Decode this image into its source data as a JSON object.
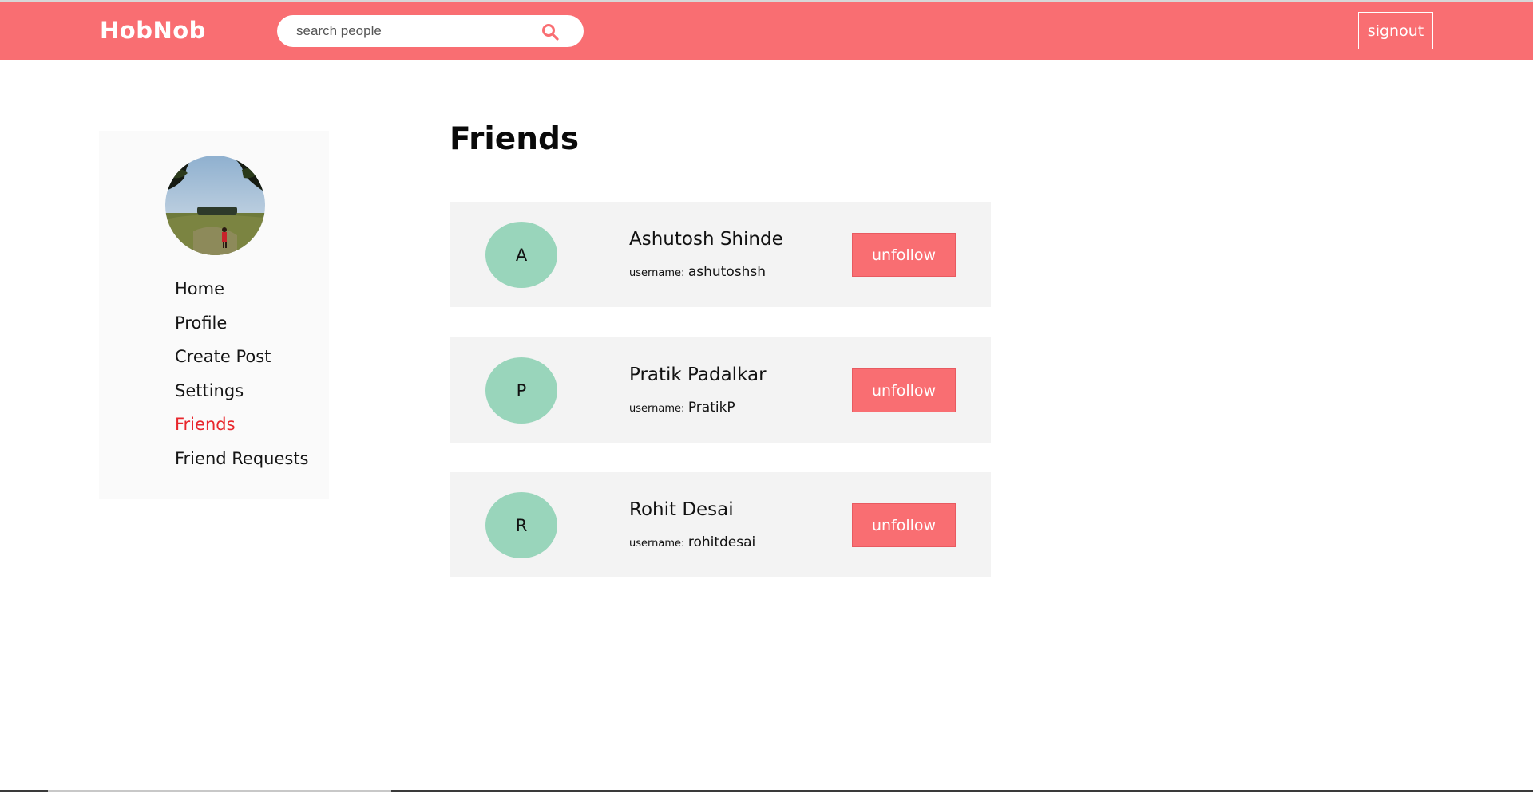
{
  "header": {
    "brand": "HobNob",
    "search_placeholder": "search people",
    "signout_label": "signout",
    "icons": {
      "search": "search-icon"
    },
    "colors": {
      "accent": "#f96e72"
    }
  },
  "sidebar": {
    "avatar": "profile-photo",
    "items": [
      {
        "label": "Home",
        "active": false
      },
      {
        "label": "Profile",
        "active": false
      },
      {
        "label": "Create Post",
        "active": false
      },
      {
        "label": "Settings",
        "active": false
      },
      {
        "label": "Friends",
        "active": true
      },
      {
        "label": "Friend Requests",
        "active": false
      }
    ]
  },
  "main": {
    "title": "Friends",
    "username_label": "username:",
    "friends": [
      {
        "initial": "A",
        "name": "Ashutosh Shinde",
        "username": "ashutoshsh",
        "action": "unfollow"
      },
      {
        "initial": "P",
        "name": "Pratik Padalkar",
        "username": "PratikP",
        "action": "unfollow"
      },
      {
        "initial": "R",
        "name": "Rohit Desai",
        "username": "rohitdesai",
        "action": "unfollow"
      }
    ],
    "colors": {
      "initial_bg": "#99d5bb",
      "card_bg": "#f3f3f3",
      "active_nav": "#e8262c"
    }
  }
}
